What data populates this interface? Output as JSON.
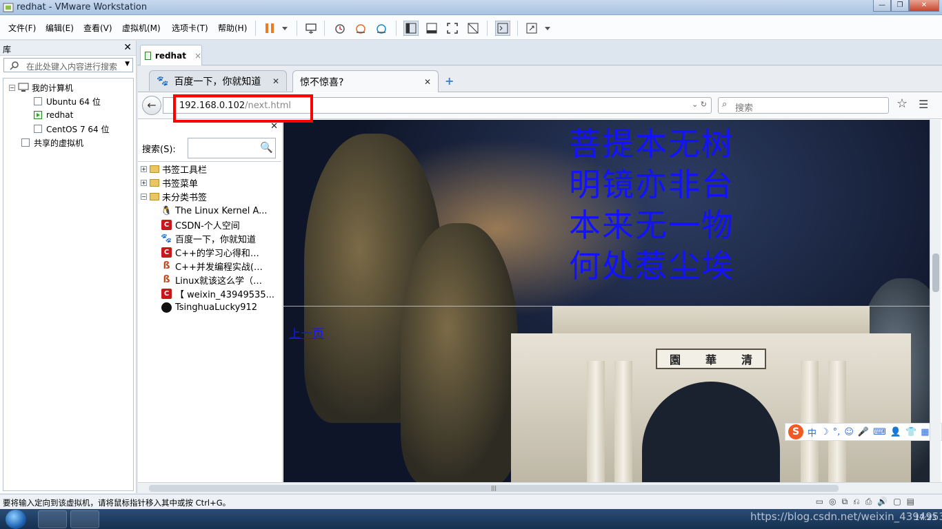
{
  "window": {
    "title": "redhat - VMware Workstation",
    "min_label": "—",
    "max_label": "❐",
    "close_label": "✕"
  },
  "menu": [
    "文件(F)",
    "编辑(E)",
    "查看(V)",
    "虚拟机(M)",
    "选项卡(T)",
    "帮助(H)"
  ],
  "library": {
    "title": "库",
    "close": "✕",
    "search_placeholder": "在此处键入内容进行搜索",
    "tree": {
      "root": "我的计算机",
      "vms": [
        "Ubuntu 64 位",
        "redhat",
        "CentOS 7 64 位"
      ],
      "shared": "共享的虚拟机"
    }
  },
  "workspace_tab": {
    "label": "redhat",
    "close": "×"
  },
  "firefox": {
    "tabs": [
      {
        "label": "百度一下，你就知道",
        "close": "✕"
      },
      {
        "label": "惊不惊喜?",
        "close": "✕"
      }
    ],
    "new_tab": "+",
    "url_host": "192.168.0.102",
    "url_path": "/next.html",
    "search_placeholder": "搜索",
    "sidebar": {
      "close": "✕",
      "search_label": "搜索(S):",
      "folders": [
        "书签工具栏",
        "书签菜单",
        "未分类书签"
      ],
      "bookmarks": [
        {
          "icon": "tux-icon",
          "label": "The Linux Kernel A..."
        },
        {
          "icon": "csdn-icon",
          "label": "CSDN-个人空间"
        },
        {
          "icon": "baidu-icon",
          "label": "百度一下，你就知道"
        },
        {
          "icon": "csdn-icon",
          "label": "C++的学习心得和…"
        },
        {
          "icon": "b3-icon",
          "label": "C++并发编程实战(…"
        },
        {
          "icon": "b3-icon",
          "label": "Linux就该这么学（…"
        },
        {
          "icon": "csdn-icon",
          "label": "【 weixin_43949535..."
        },
        {
          "icon": "github-icon",
          "label": "TsinghuaLucky912"
        }
      ]
    },
    "page": {
      "poem": [
        "菩提本无树",
        "明镜亦非台",
        "本来无一物",
        "何处惹尘埃"
      ],
      "gate_sign": [
        "園",
        "華",
        "清"
      ],
      "prev_link": "上一页"
    },
    "ime": {
      "logo": "S",
      "items": [
        "中",
        "☽",
        "°,",
        "☺",
        "🎤",
        "⌨",
        "👤",
        "👕",
        "▦"
      ]
    }
  },
  "statusbar": {
    "message": "要将输入定向到该虚拟机，请将鼠标指针移入其中或按 Ctrl+G。"
  },
  "taskbar": {
    "time": "17:23"
  },
  "watermark": "https://blog.csdn.net/weixin_43949535"
}
